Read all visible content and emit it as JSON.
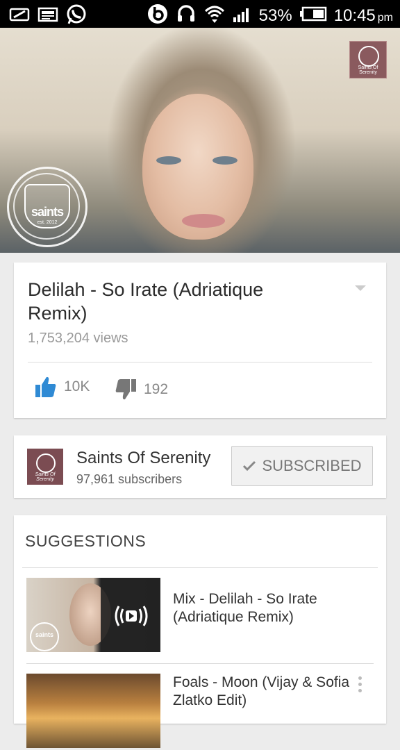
{
  "status_bar": {
    "battery_percent": "53%",
    "time": "10:45",
    "time_suffix": "pm",
    "left_icons": [
      "email-icon",
      "news-icon",
      "whatsapp-icon"
    ],
    "right_icons": [
      "beats-icon",
      "headset-icon",
      "wifi-icon",
      "signal-icon",
      "battery-icon"
    ]
  },
  "video": {
    "channel_corner_label": "Saints Of Serenity",
    "watermark_word": "saints",
    "watermark_sub": "est. 2012"
  },
  "info": {
    "title": "Delilah - So Irate (Adriatique Remix)",
    "views": "1,753,204 views",
    "likes": "10K",
    "dislikes": "192"
  },
  "channel": {
    "name": "Saints Of Serenity",
    "subscribers": "97,961 subscribers",
    "thumb_label": "Saints Of Serenity",
    "subscribe_label": "SUBSCRIBED"
  },
  "suggestions": {
    "heading": "SUGGESTIONS",
    "items": [
      {
        "title": "Mix - Delilah - So Irate (Adriatique Remix)",
        "badge": "saints"
      },
      {
        "title": "Foals - Moon (Vijay & Sofia Zlatko Edit)"
      }
    ]
  },
  "colors": {
    "accent_blue": "#2f8ad4",
    "dislike_gray": "#777777"
  }
}
